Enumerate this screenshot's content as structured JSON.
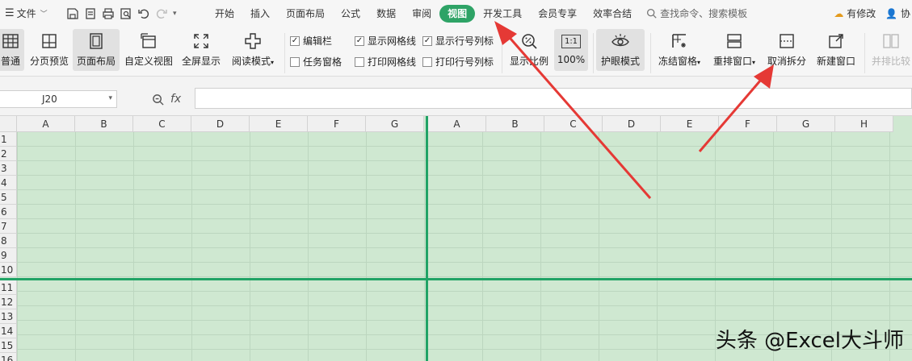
{
  "menubar": {
    "file_label": "文件",
    "tabs": [
      {
        "label": "开始",
        "active": false
      },
      {
        "label": "插入",
        "active": false
      },
      {
        "label": "页面布局",
        "active": false
      },
      {
        "label": "公式",
        "active": false
      },
      {
        "label": "数据",
        "active": false
      },
      {
        "label": "审阅",
        "active": false
      },
      {
        "label": "视图",
        "active": true
      },
      {
        "label": "开发工具",
        "active": false
      },
      {
        "label": "会员专享",
        "active": false
      },
      {
        "label": "效率合结",
        "active": false
      }
    ],
    "search_placeholder": "查找命令、搜索模板",
    "modified_label": "有修改",
    "collab_label": "协"
  },
  "ribbon": {
    "normal": "普通",
    "page_break_preview": "分页预览",
    "page_layout": "页面布局",
    "custom_view": "自定义视图",
    "full_screen": "全屏显示",
    "reading_mode": "阅读模式",
    "checkboxes": {
      "edit_bar": {
        "label": "编辑栏",
        "checked": true
      },
      "show_gridlines": {
        "label": "显示网格线",
        "checked": true
      },
      "show_headings": {
        "label": "显示行号列标",
        "checked": true
      },
      "task_pane": {
        "label": "任务窗格",
        "checked": false
      },
      "print_gridlines": {
        "label": "打印网格线",
        "checked": false
      },
      "print_headings": {
        "label": "打印行号列标",
        "checked": false
      }
    },
    "zoom_ratio": "显示比例",
    "zoom_100": "100%",
    "zoom_100_icon": "1:1",
    "eye_protection": "护眼模式",
    "freeze_panes": "冻结窗格",
    "arrange_windows": "重排窗口",
    "cancel_split": "取消拆分",
    "new_window": "新建窗口",
    "side_by_side": "并排比较"
  },
  "formula_bar": {
    "cell_ref": "J20",
    "fx_label": "fx",
    "formula_value": ""
  },
  "sheet": {
    "columns_left": [
      "A",
      "B",
      "C",
      "D",
      "E",
      "F",
      "G"
    ],
    "columns_right": [
      "A",
      "B",
      "C",
      "D",
      "E",
      "F",
      "G",
      "H"
    ],
    "rows_top": [
      "1",
      "2",
      "3",
      "4",
      "5",
      "6",
      "7",
      "8",
      "9",
      "10"
    ],
    "rows_bottom": [
      "11",
      "12",
      "13",
      "14",
      "15",
      "16"
    ],
    "cell_background": "#cfe8d1",
    "split_color": "#21a366"
  },
  "annotation_color": "#e53935",
  "watermark": "头条 @Excel大斗师"
}
